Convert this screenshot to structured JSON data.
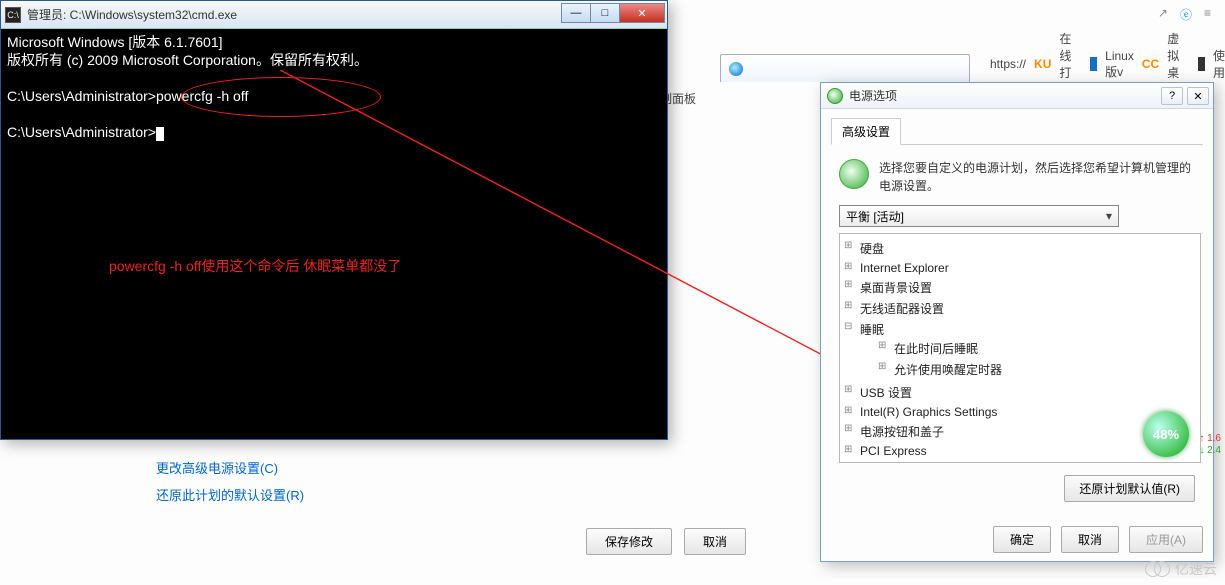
{
  "browser": {
    "https_label": "https://",
    "bookmarks": [
      {
        "tag": "KU",
        "label": "在线打字"
      },
      {
        "tag": "sq",
        "label": "Linux版v"
      },
      {
        "tag": "CC",
        "label": "虚拟桌面"
      },
      {
        "tag": "vm",
        "label": "使用"
      }
    ],
    "tab_label": ""
  },
  "control_panel": {
    "header": "制面板",
    "link_advanced": "更改高级电源设置(C)",
    "link_restore": "还原此计划的默认设置(R)",
    "save_btn": "保存修改",
    "cancel_btn": "取消"
  },
  "cmd": {
    "title": "管理员: C:\\Windows\\system32\\cmd.exe",
    "line1": "Microsoft Windows [版本 6.1.7601]",
    "line2": "版权所有 (c) 2009 Microsoft Corporation。保留所有权利。",
    "prompt1": "C:\\Users\\Administrator>powercfg -h off",
    "prompt2": "C:\\Users\\Administrator>",
    "annotation": "powercfg -h off使用这个命令后 休眠菜单都没了"
  },
  "power": {
    "title": "电源选项",
    "tab": "高级设置",
    "desc": "选择您要自定义的电源计划，然后选择您希望计算机管理的电源设置。",
    "plan": "平衡 [活动]",
    "tree": {
      "n0": "硬盘",
      "n1": "Internet Explorer",
      "n2": "桌面背景设置",
      "n3": "无线适配器设置",
      "n4": "睡眠",
      "n4a": "在此时间后睡眠",
      "n4b": "允许使用唤醒定时器",
      "n5": "USB 设置",
      "n6": "Intel(R) Graphics Settings",
      "n7": "电源按钮和盖子",
      "n8": "PCI Express"
    },
    "restore_btn": "还原计划默认值(R)",
    "ok": "确定",
    "cancel": "取消",
    "apply": "应用(A)"
  },
  "badge": {
    "percent": "48%",
    "up": "1.6",
    "down": "2.4"
  },
  "watermark": "亿速云"
}
